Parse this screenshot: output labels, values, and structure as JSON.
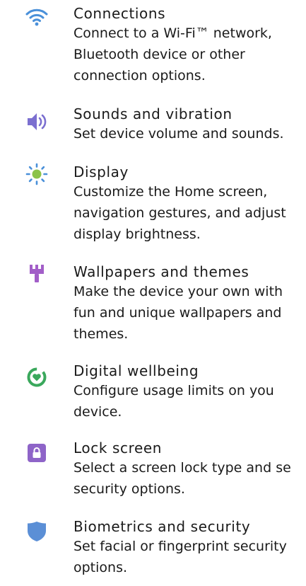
{
  "settings": [
    {
      "title": "Connections",
      "icon": "wifi-icon",
      "description_lines": [
        "Connect to a Wi-Fi™ network,",
        "Bluetooth device or other",
        "connection options."
      ]
    },
    {
      "title": "Sounds and vibration",
      "icon": "speaker-icon",
      "description_lines": [
        "Set device volume and sounds."
      ]
    },
    {
      "title": "Display",
      "icon": "sun-icon",
      "description_lines": [
        "Customize the Home screen,",
        "navigation gestures, and adjust",
        "display brightness."
      ]
    },
    {
      "title": "Wallpapers and themes",
      "icon": "paintbrush-icon",
      "description_lines": [
        "Make the device your own with",
        "fun and unique wallpapers and",
        "themes."
      ]
    },
    {
      "title": "Digital wellbeing",
      "icon": "wellbeing-heart-icon",
      "description_lines": [
        "Configure usage limits on you",
        "device."
      ]
    },
    {
      "title": "Lock screen",
      "icon": "lock-icon",
      "description_lines": [
        "Select a screen lock type and se",
        "security options."
      ]
    },
    {
      "title": "Biometrics and security",
      "icon": "shield-icon",
      "description_lines": [
        "Set facial or fingerprint security",
        "options."
      ]
    }
  ],
  "colors": {
    "wifi": "#4a90d9",
    "sound": "#7b6fd0",
    "display": "#8bc34a",
    "display_rays": "#4a90d9",
    "wallpaper": "#a25ec8",
    "wellbeing": "#3aa85c",
    "lock": "#8e64c8",
    "biometrics": "#5b8fd6"
  }
}
